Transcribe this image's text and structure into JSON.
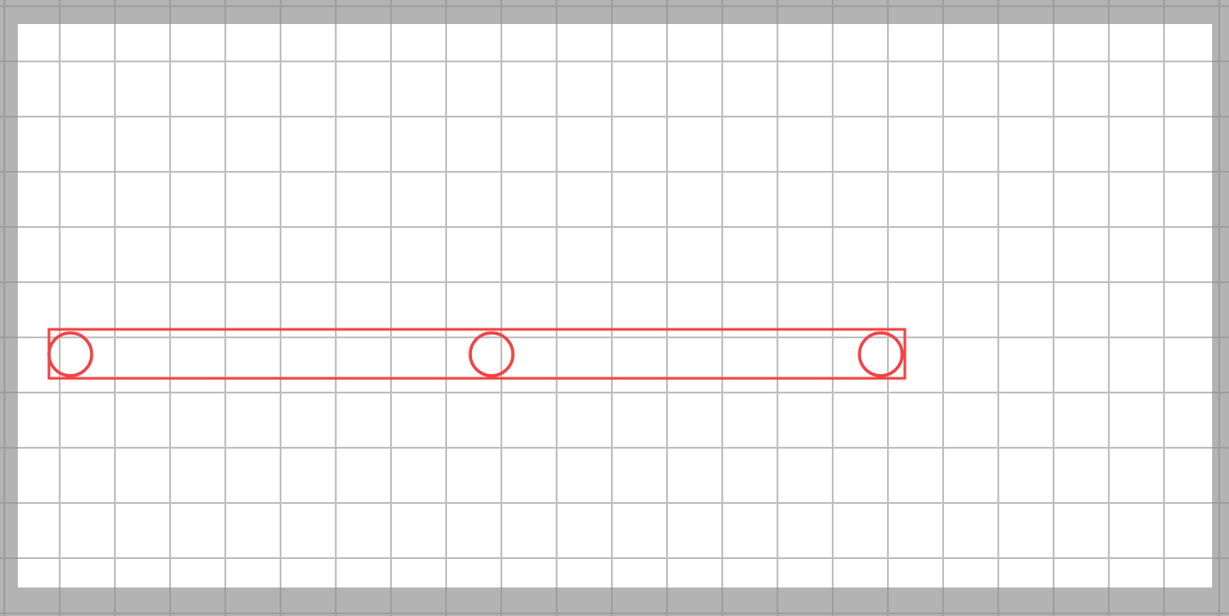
{
  "colors": {
    "frame": "#b3b3b3",
    "canvas": "#ffffff",
    "grid_on_canvas": "#bfbfbf",
    "grid_on_frame": "#9e9e9e",
    "shape_stroke": "#f04444"
  },
  "shapes": {
    "bar": "rectangle",
    "markers": [
      "circle",
      "circle",
      "circle"
    ]
  }
}
